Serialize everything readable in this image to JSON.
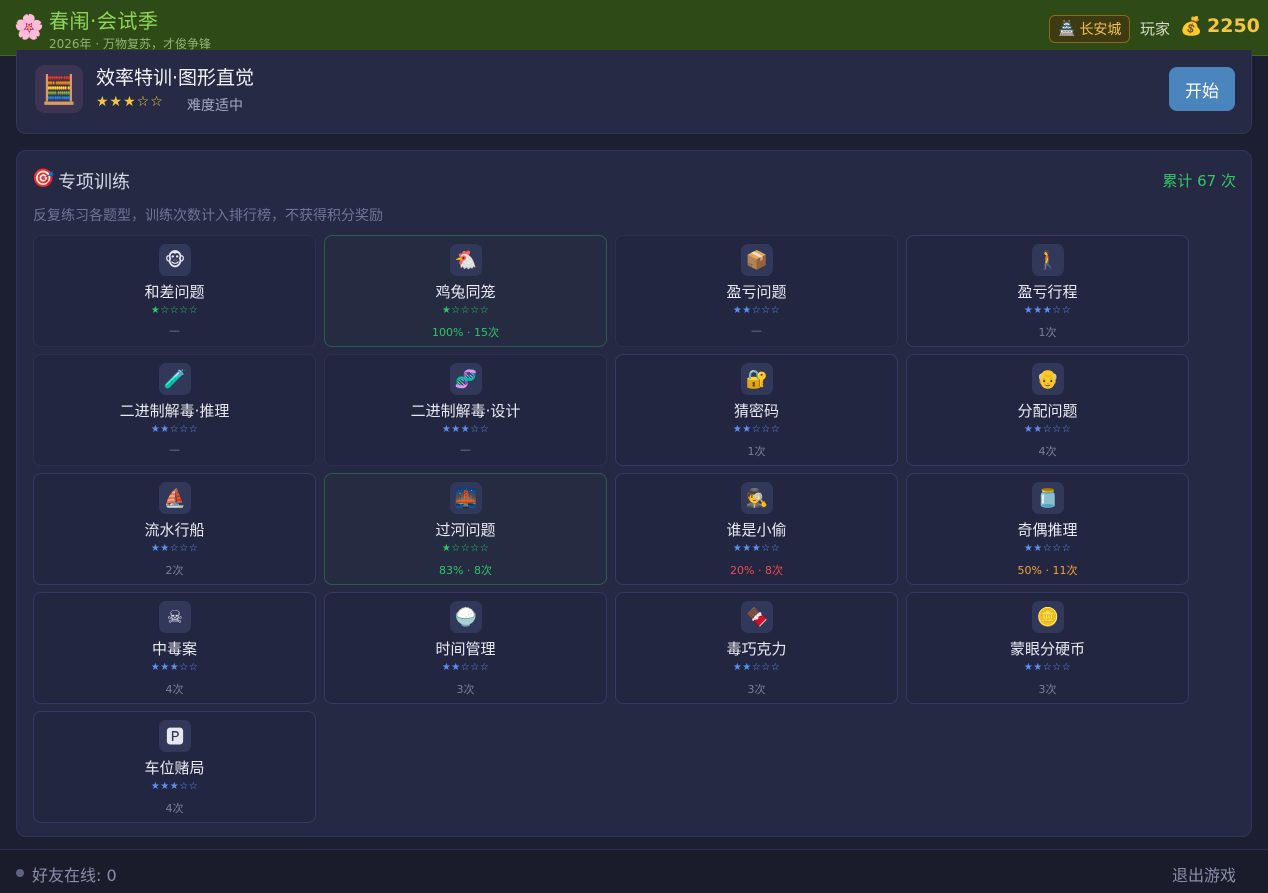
{
  "header": {
    "logo_icon": "cherry-blossom",
    "title": "春闱·会试季",
    "subtitle": "2026年 · 万物复苏，才俊争锋",
    "city_icon": "pagoda",
    "city": "长安城",
    "player": "玩家",
    "coin_icon": "money-bag",
    "coins": "2250"
  },
  "featured": {
    "icon": "abacus",
    "title": "效率特训·图形直觉",
    "stars": "★★★☆☆",
    "difficulty": "难度适中",
    "start_label": "开始"
  },
  "training": {
    "icon": "target",
    "title": "专项训练",
    "total": "累计 67 次",
    "description": "反复练习各题型，训练次数计入排行榜，不获得积分奖励",
    "items": [
      {
        "icon": "🐵",
        "name": "和差问题",
        "stars": "★☆☆☆☆",
        "star_color": "green",
        "stats": "—",
        "stats_color": "gray",
        "border": "dim"
      },
      {
        "icon": "🐔",
        "name": "鸡兔同笼",
        "stars": "★☆☆☆☆",
        "star_color": "green",
        "stats": "100% · 15次",
        "stats_color": "green",
        "border": "green"
      },
      {
        "icon": "📦",
        "name": "盈亏问题",
        "stars": "★★☆☆☆",
        "star_color": "blue",
        "stats": "—",
        "stats_color": "gray",
        "border": "dim"
      },
      {
        "icon": "🚶",
        "name": "盈亏行程",
        "stars": "★★★☆☆",
        "star_color": "blue",
        "stats": "1次",
        "stats_color": "gray",
        "border": "blue"
      },
      {
        "icon": "🧪",
        "name": "二进制解毒·推理",
        "stars": "★★☆☆☆",
        "star_color": "blue",
        "stats": "—",
        "stats_color": "gray",
        "border": "dim"
      },
      {
        "icon": "🧬",
        "name": "二进制解毒·设计",
        "stars": "★★★☆☆",
        "star_color": "blue",
        "stats": "—",
        "stats_color": "gray",
        "border": "dim"
      },
      {
        "icon": "🔐",
        "name": "猜密码",
        "stars": "★★☆☆☆",
        "star_color": "blue",
        "stats": "1次",
        "stats_color": "gray",
        "border": "blue"
      },
      {
        "icon": "👴",
        "name": "分配问题",
        "stars": "★★☆☆☆",
        "star_color": "blue",
        "stats": "4次",
        "stats_color": "gray",
        "border": "blue"
      },
      {
        "icon": "⛵",
        "name": "流水行船",
        "stars": "★★☆☆☆",
        "star_color": "blue",
        "stats": "2次",
        "stats_color": "gray",
        "border": "blue"
      },
      {
        "icon": "🌉",
        "name": "过河问题",
        "stars": "★☆☆☆☆",
        "star_color": "green",
        "stats": "83% · 8次",
        "stats_color": "green",
        "border": "green"
      },
      {
        "icon": "🕵",
        "name": "谁是小偷",
        "stars": "★★★☆☆",
        "star_color": "blue",
        "stats": "20% · 8次",
        "stats_color": "red",
        "border": "blue"
      },
      {
        "icon": "🫙",
        "name": "奇偶推理",
        "stars": "★★☆☆☆",
        "star_color": "blue",
        "stats": "50% · 11次",
        "stats_color": "orange",
        "border": "blue"
      },
      {
        "icon": "☠",
        "name": "中毒案",
        "stars": "★★★☆☆",
        "star_color": "blue",
        "stats": "4次",
        "stats_color": "gray",
        "border": "blue"
      },
      {
        "icon": "🍚",
        "name": "时间管理",
        "stars": "★★☆☆☆",
        "star_color": "blue",
        "stats": "3次",
        "stats_color": "gray",
        "border": "blue"
      },
      {
        "icon": "🍫",
        "name": "毒巧克力",
        "stars": "★★☆☆☆",
        "star_color": "blue",
        "stats": "3次",
        "stats_color": "gray",
        "border": "blue"
      },
      {
        "icon": "🪙",
        "name": "蒙眼分硬币",
        "stars": "★★☆☆☆",
        "star_color": "blue",
        "stats": "3次",
        "stats_color": "gray",
        "border": "blue"
      },
      {
        "icon": "🅿",
        "name": "车位赌局",
        "stars": "★★★☆☆",
        "star_color": "blue",
        "stats": "4次",
        "stats_color": "gray",
        "border": "blue"
      }
    ]
  },
  "footer": {
    "online": "好友在线: 0",
    "exit_label": "退出游戏"
  }
}
